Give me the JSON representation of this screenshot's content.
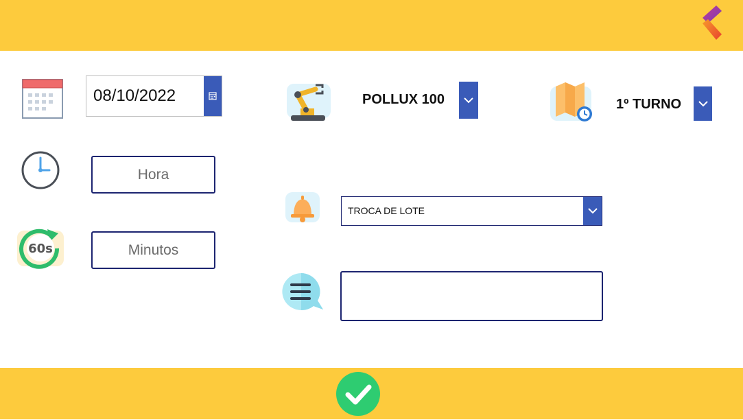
{
  "header": {
    "back_icon": "back-chevron-icon",
    "accent": "#fdcb3d"
  },
  "form": {
    "date": {
      "value": "08/10/2022",
      "icon": "calendar-icon",
      "button_icon": "calendar-picker-icon"
    },
    "hour": {
      "placeholder": "Hora",
      "icon": "clock-icon"
    },
    "minutes": {
      "placeholder": "Minutos",
      "icon": "timer-60s-icon"
    },
    "machine": {
      "selected": "POLLUX 100",
      "icon": "robot-arm-icon"
    },
    "shift": {
      "selected": "1º TURNO",
      "icon": "map-clock-icon"
    },
    "event": {
      "selected": "TROCA DE LOTE",
      "icon": "bell-icon"
    },
    "comment": {
      "value": "",
      "icon": "comment-bubble-icon"
    }
  },
  "footer": {
    "confirm_icon": "checkmark-icon",
    "confirm_color": "#2ecc71"
  }
}
